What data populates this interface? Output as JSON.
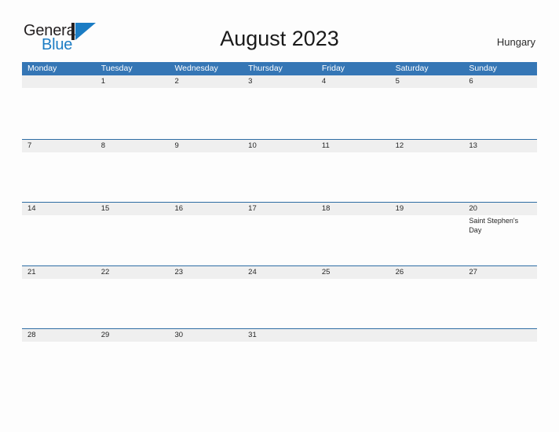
{
  "brand": {
    "name_part1": "General",
    "name_part2": "Blue",
    "logo_icon": "triangle-flag-logo"
  },
  "header": {
    "title": "August 2023",
    "country": "Hungary"
  },
  "calendar": {
    "weekdays": [
      "Monday",
      "Tuesday",
      "Wednesday",
      "Thursday",
      "Friday",
      "Saturday",
      "Sunday"
    ],
    "colors": {
      "header_blue": "#3576b5",
      "row_divider_blue": "#2e6da4",
      "day_band_gray": "#efefef",
      "page_background": "#fdfdfd",
      "logo_blue": "#1b7cc4",
      "text_dark": "#262626"
    },
    "weeks": [
      [
        {
          "day": "",
          "events": []
        },
        {
          "day": "1",
          "events": []
        },
        {
          "day": "2",
          "events": []
        },
        {
          "day": "3",
          "events": []
        },
        {
          "day": "4",
          "events": []
        },
        {
          "day": "5",
          "events": []
        },
        {
          "day": "6",
          "events": []
        }
      ],
      [
        {
          "day": "7",
          "events": []
        },
        {
          "day": "8",
          "events": []
        },
        {
          "day": "9",
          "events": []
        },
        {
          "day": "10",
          "events": []
        },
        {
          "day": "11",
          "events": []
        },
        {
          "day": "12",
          "events": []
        },
        {
          "day": "13",
          "events": []
        }
      ],
      [
        {
          "day": "14",
          "events": []
        },
        {
          "day": "15",
          "events": []
        },
        {
          "day": "16",
          "events": []
        },
        {
          "day": "17",
          "events": []
        },
        {
          "day": "18",
          "events": []
        },
        {
          "day": "19",
          "events": []
        },
        {
          "day": "20",
          "events": [
            "Saint Stephen's Day"
          ]
        }
      ],
      [
        {
          "day": "21",
          "events": []
        },
        {
          "day": "22",
          "events": []
        },
        {
          "day": "23",
          "events": []
        },
        {
          "day": "24",
          "events": []
        },
        {
          "day": "25",
          "events": []
        },
        {
          "day": "26",
          "events": []
        },
        {
          "day": "27",
          "events": []
        }
      ],
      [
        {
          "day": "28",
          "events": []
        },
        {
          "day": "29",
          "events": []
        },
        {
          "day": "30",
          "events": []
        },
        {
          "day": "31",
          "events": []
        },
        {
          "day": "",
          "events": []
        },
        {
          "day": "",
          "events": []
        },
        {
          "day": "",
          "events": []
        }
      ]
    ]
  }
}
